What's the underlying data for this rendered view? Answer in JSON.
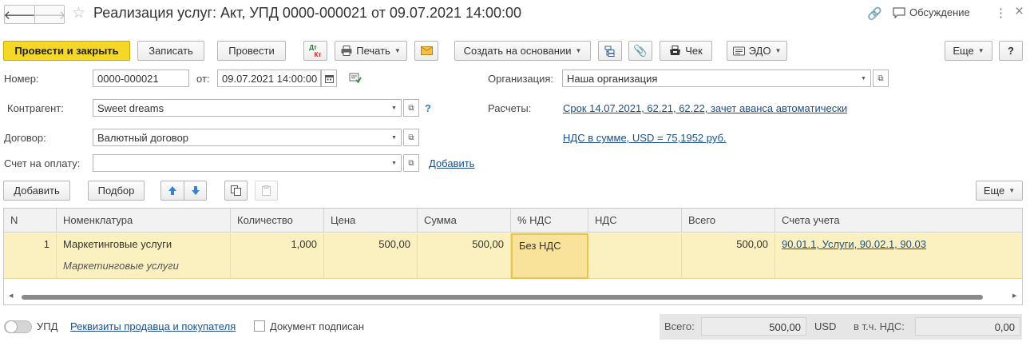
{
  "window": {
    "title": "Реализация услуг: Акт, УПД 0000-000021 от 09.07.2021 14:00:00",
    "discuss_label": "Обсуждение"
  },
  "toolbar": {
    "post_close": "Провести и закрыть",
    "save": "Записать",
    "post": "Провести",
    "dtkt_top": "Дт",
    "dtkt_bottom": "Кт",
    "print": "Печать",
    "create_based": "Создать на основании",
    "check": "Чек",
    "edo": "ЭДО",
    "more": "Еще",
    "help": "?"
  },
  "form": {
    "number_label": "Номер:",
    "number_value": "0000-000021",
    "date_label": "от:",
    "date_value": "09.07.2021 14:00:00",
    "org_label": "Организация:",
    "org_value": "Наша организация",
    "contractor_label": "Контрагент:",
    "contractor_value": "Sweet dreams",
    "contractor_help": "?",
    "settlements_label": "Расчеты:",
    "settlements_link": "Срок 14.07.2021, 62.21, 62.22, зачет аванса автоматически",
    "contract_label": "Договор:",
    "contract_value": "Валютный договор",
    "vat_link": "НДС в сумме, USD = 75,1952 руб.",
    "invoice_label": "Счет на оплату:",
    "invoice_value": "",
    "add_link": "Добавить"
  },
  "table_toolbar": {
    "add": "Добавить",
    "pick": "Подбор",
    "more": "Еще"
  },
  "table": {
    "columns": [
      "N",
      "Номенклатура",
      "Количество",
      "Цена",
      "Сумма",
      "% НДС",
      "НДС",
      "Всего",
      "Счета учета"
    ],
    "rows": [
      {
        "n": "1",
        "item": "Маркетинговые услуги",
        "item_sub": "Маркетинговые услуги",
        "qty": "1,000",
        "price": "500,00",
        "sum": "500,00",
        "vat_rate": "Без НДС",
        "vat": "",
        "total": "500,00",
        "accounts": "90.01.1, Услуги, 90.02.1, 90.03"
      }
    ]
  },
  "bottom": {
    "upd_label": "УПД",
    "requisites_link": "Реквизиты продавца и покупателя",
    "signed_label": "Документ подписан",
    "total_label": "Всего:",
    "total_value": "500,00",
    "currency": "USD",
    "vat_label": "в т.ч. НДС:",
    "vat_value": "0,00"
  }
}
